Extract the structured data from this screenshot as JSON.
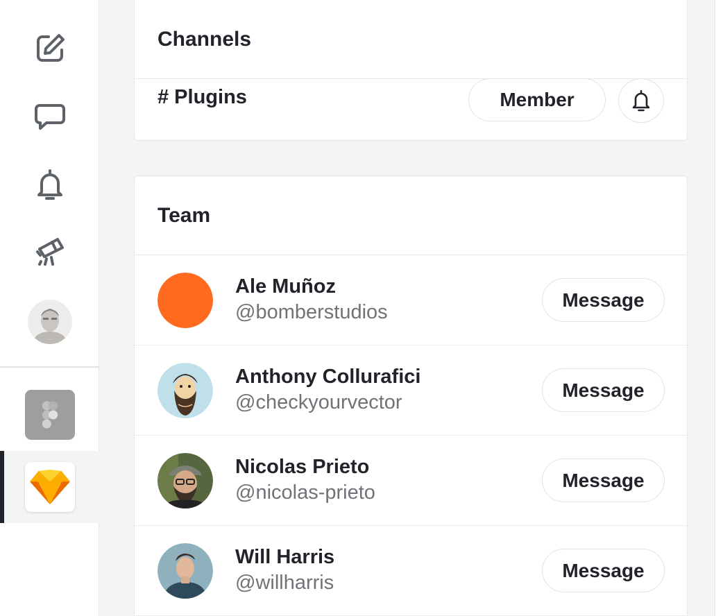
{
  "sidebar": {
    "icons": [
      "compose-icon",
      "chat-icon",
      "bell-icon",
      "telescope-icon"
    ],
    "apps": [
      "figma-icon",
      "sketch-icon"
    ]
  },
  "channels": {
    "title": "Channels",
    "items": [
      {
        "name": "# Plugins",
        "member_label": "Member"
      }
    ]
  },
  "team": {
    "title": "Team",
    "message_label": "Message",
    "members": [
      {
        "name": "Ale Muñoz",
        "handle": "@bomberstudios",
        "avatar_color": "#ff6a1f"
      },
      {
        "name": "Anthony Collurafici",
        "handle": "@checkyourvector",
        "avatar_color": "#bfe0ea"
      },
      {
        "name": "Nicolas Prieto",
        "handle": "@nicolas-prieto",
        "avatar_color": "#5a6b4a"
      },
      {
        "name": "Will Harris",
        "handle": "@willharris",
        "avatar_color": "#7fa6b5"
      }
    ]
  },
  "colors": {
    "text_primary": "#202329",
    "text_secondary": "#6f7378",
    "border": "#e6e6e6",
    "sketch_yellow": "#fdb300"
  }
}
